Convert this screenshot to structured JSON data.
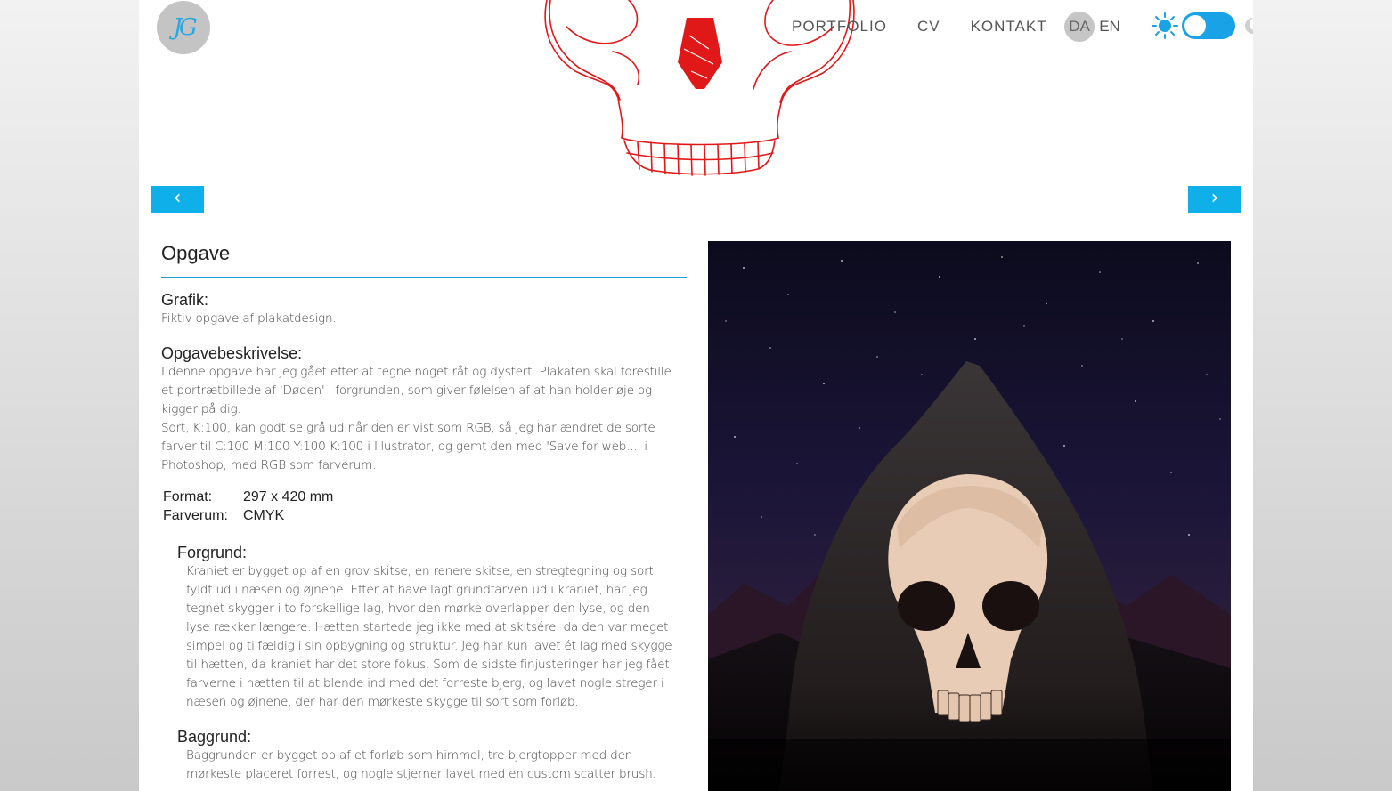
{
  "header": {
    "logo_text": "JG",
    "nav": [
      {
        "label": "PORTFOLIO"
      },
      {
        "label": "CV"
      },
      {
        "label": "KONTAKT"
      }
    ],
    "languages": [
      {
        "label": "DA",
        "active": true
      },
      {
        "label": "EN",
        "active": false
      }
    ],
    "theme_toggle": {
      "state": "light",
      "accent": "#1aa2e6"
    }
  },
  "carousel": {
    "prev_label": "‹",
    "next_label": "›",
    "accent": "#0fb0ea"
  },
  "content": {
    "title": "Opgave",
    "grafik_heading": "Grafik:",
    "grafik_text": "Fiktiv opgave af plakatdesign.",
    "desc_heading": "Opgavebeskrivelse:",
    "desc_lines": [
      "I denne opgave har jeg gået efter at tegne noget råt og dystert. Plakaten skal forestille",
      "et portrætbillede af 'Døden' i forgrunden, som giver følelsen af at han holder øje og",
      "kigger på dig.",
      "Sort, K:100, kan godt se grå ud når den er vist som RGB, så jeg har ændret de sorte",
      "farver til C:100 M:100 Y:100 K:100 i Illustrator, og gemt den med 'Save for web...' i",
      "Photoshop, med RGB som farverum."
    ],
    "specs": [
      {
        "key": "Format:",
        "value": "297 x 420 mm"
      },
      {
        "key": "Farverum:",
        "value": "CMYK"
      }
    ],
    "forgrund_heading": "Forgrund:",
    "forgrund_lines": [
      "Kraniet er bygget op af en grov skitse, en renere skitse, en stregtegning og sort",
      "fyldt ud i næsen og øjnene. Efter at have lagt grundfarven ud i kraniet, har jeg",
      "tegnet skygger i to forskellige lag, hvor den mørke overlapper den lyse, og den",
      "lyse rækker længere. Hætten startede jeg ikke med at skitsére, da den var meget",
      "simpel og tilfældig i sin opbygning og struktur. Jeg har kun lavet ét lag med skygge",
      "til hætten, da kraniet har det store fokus. Som de sidste finjusteringer har jeg fået",
      "farverne i hætten til at blende ind med det forreste bjerg, og lavet nogle streger i",
      "næsen og øjnene, der har den mørkeste skygge til sort som forløb."
    ],
    "baggrund_heading": "Baggrund:",
    "baggrund_lines": [
      "Baggrunden er bygget op af et forløb som himmel, tre bjergtopper med den",
      "mørkeste placeret forrest, og nogle stjerner lavet med en custom scatter brush."
    ]
  },
  "colors": {
    "accent": "#18a4d8",
    "sketch": "#e01818"
  }
}
